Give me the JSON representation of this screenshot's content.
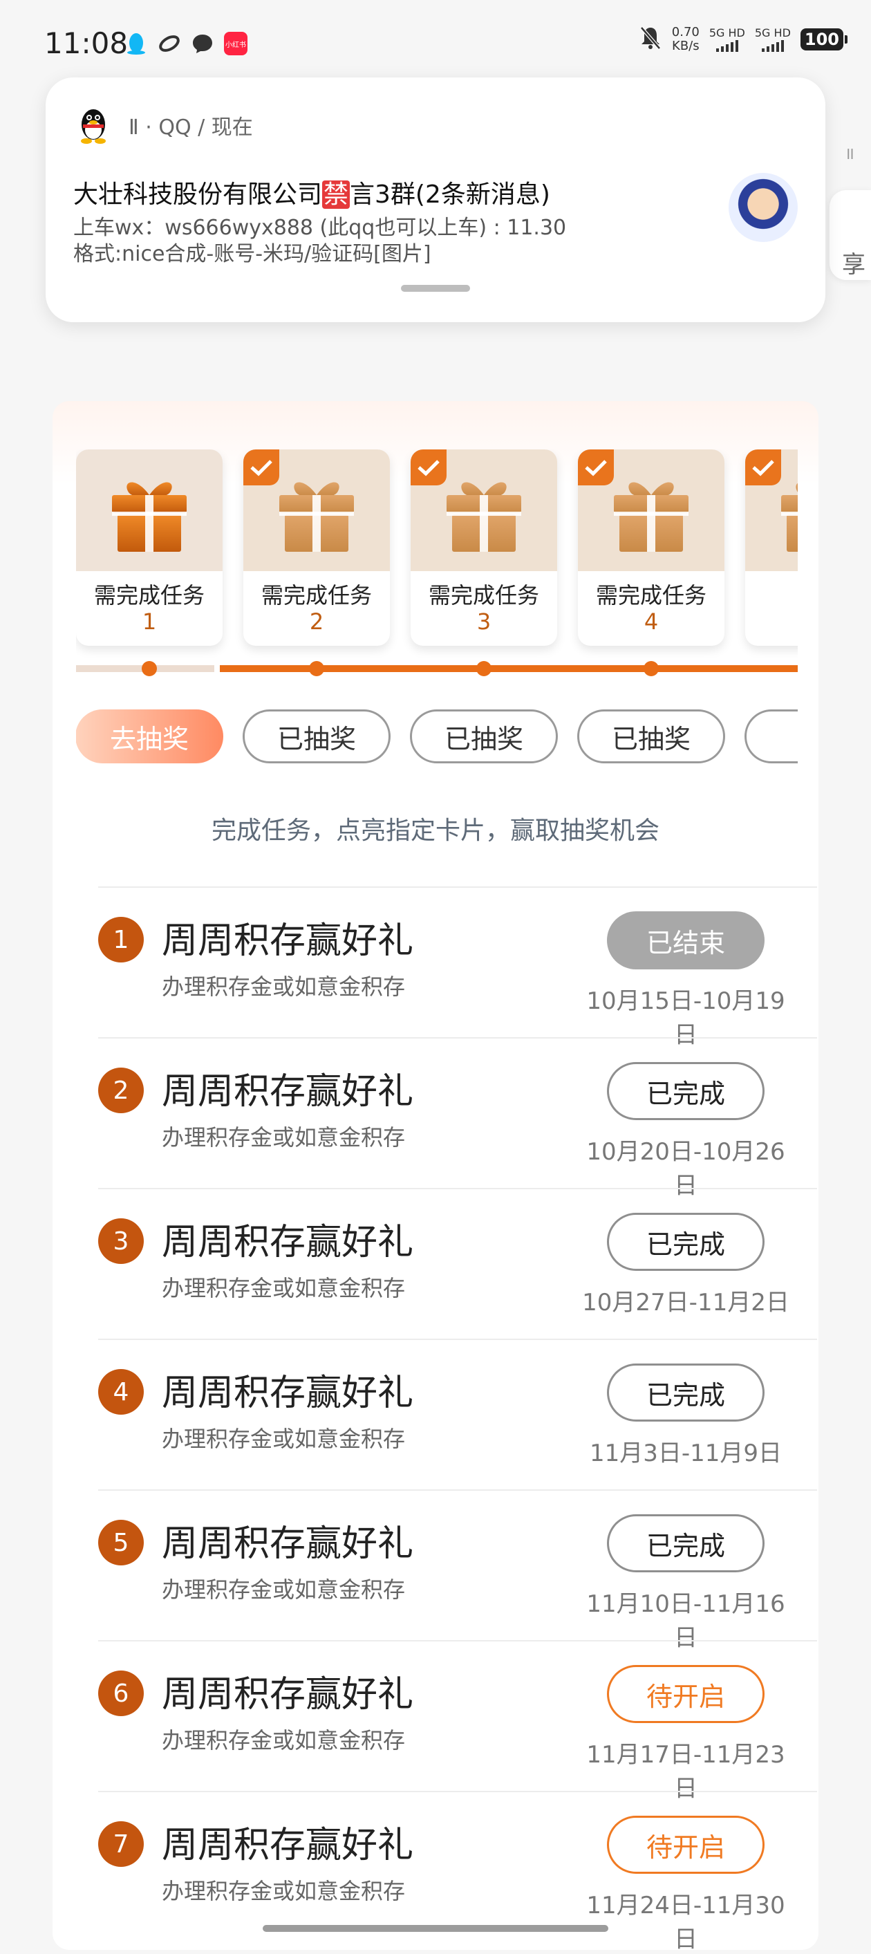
{
  "status_bar": {
    "time": "11:08",
    "net_speed_value": "0.70",
    "net_speed_unit": "KB/s",
    "sim1": "5G HD",
    "sim2": "5G HD",
    "battery": "100",
    "xhs_label": "小红书"
  },
  "notification": {
    "app": "Ⅱ · QQ / 现在",
    "title_prefix": "大壮科技股份有限公司",
    "title_badge": "禁",
    "title_suffix": "言3群(2条新消息)",
    "line1": "上车wx：ws666wyx888 (此qq也可以上车) : 11.30",
    "line2": "格式:nice合成-账号-米玛/验证码[图片]"
  },
  "background": {
    "share_text": "享",
    "ticks": "॥"
  },
  "gift_cards": [
    {
      "label": "需完成任务",
      "num": "1",
      "checked": false
    },
    {
      "label": "需完成任务",
      "num": "2",
      "checked": true
    },
    {
      "label": "需完成任务",
      "num": "3",
      "checked": true
    },
    {
      "label": "需完成任务",
      "num": "4",
      "checked": true
    },
    {
      "label": "需完",
      "num": "",
      "checked": true
    }
  ],
  "draw_buttons": [
    {
      "label": "去抽奖",
      "active": true
    },
    {
      "label": "已抽奖",
      "active": false
    },
    {
      "label": "已抽奖",
      "active": false
    },
    {
      "label": "已抽奖",
      "active": false
    },
    {
      "label": "已",
      "active": false
    }
  ],
  "hint": "完成任务，点亮指定卡片，赢取抽奖机会",
  "tasks": [
    {
      "num": "1",
      "title": "周周积存赢好礼",
      "sub": "办理积存金或如意金积存",
      "status": "已结束",
      "state": "ended",
      "date": "10月15日-10月19日"
    },
    {
      "num": "2",
      "title": "周周积存赢好礼",
      "sub": "办理积存金或如意金积存",
      "status": "已完成",
      "state": "done",
      "date": "10月20日-10月26日"
    },
    {
      "num": "3",
      "title": "周周积存赢好礼",
      "sub": "办理积存金或如意金积存",
      "status": "已完成",
      "state": "done",
      "date": "10月27日-11月2日"
    },
    {
      "num": "4",
      "title": "周周积存赢好礼",
      "sub": "办理积存金或如意金积存",
      "status": "已完成",
      "state": "done",
      "date": "11月3日-11月9日"
    },
    {
      "num": "5",
      "title": "周周积存赢好礼",
      "sub": "办理积存金或如意金积存",
      "status": "已完成",
      "state": "done",
      "date": "11月10日-11月16日"
    },
    {
      "num": "6",
      "title": "周周积存赢好礼",
      "sub": "办理积存金或如意金积存",
      "status": "待开启",
      "state": "pending",
      "date": "11月17日-11月23日"
    },
    {
      "num": "7",
      "title": "周周积存赢好礼",
      "sub": "办理积存金或如意金积存",
      "status": "待开启",
      "state": "pending",
      "date": "11月24日-11月30日"
    }
  ],
  "colors": {
    "accent_orange": "#e96d16",
    "task_number_bg": "#c4550f",
    "pending_border": "#f07a22"
  }
}
